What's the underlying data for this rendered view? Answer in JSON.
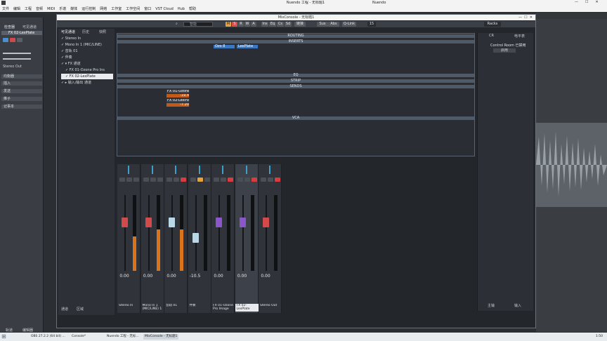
{
  "outer": {
    "title": "Nuendo 工程 - 无标题1",
    "app_name": "Nuendo",
    "menu": [
      "文件",
      "编辑",
      "工程",
      "音频",
      "MIDI",
      "乐谱",
      "媒体",
      "运行控制",
      "网络",
      "工作室",
      "工作空间",
      "窗口",
      "VST Cloud",
      "Hub",
      "帮助"
    ]
  },
  "inspector": {
    "tabs": [
      "检查器",
      "可见通道"
    ],
    "track_name": "FX 02-LexPlate",
    "sections": [
      "均衡器",
      "插入",
      "发送",
      "推子",
      "记事本"
    ],
    "bottom_tabs": [
      "轨道",
      "编辑器"
    ],
    "output": "Stereo Out"
  },
  "mix": {
    "title": "MixConsole - 无标题1",
    "toolbar": {
      "search_placeholder": "智能",
      "buttons": [
        "M",
        "S",
        "R",
        "W",
        "A"
      ],
      "tools": [
        "Ins",
        "Eq",
        "Cs",
        "Sd"
      ],
      "view_label": "链接",
      "sus": "Sus",
      "abs": "Abs",
      "qlink": "Q-Link",
      "count": "15",
      "racks": "Racks"
    },
    "left_tabs": [
      "可见通道",
      "历史",
      "快照"
    ],
    "vis_items": [
      "Stereo In",
      "Mono In 1 (MIC/LINE)",
      "音轨 01",
      "伴奏",
      "FX 通道",
      "FX 01-Ozone Pro Ins",
      "FX 02-LexPlate",
      "输入/输出 通道"
    ],
    "rack_labels": [
      "ROUTING",
      "INSERTS",
      "EQ",
      "STRIP",
      "SENDS",
      "VCA"
    ],
    "inserts": {
      "slot1": "Ozo 8",
      "slot2": "LexPlate"
    },
    "sends": {
      "send1": "FX 01-Ozone_...",
      "send1_val": "-19.4",
      "send2": "FX 02-LexPlate",
      "send2_val": "-7.20"
    },
    "channels": [
      {
        "name": "Stereo In",
        "volume": "0.00",
        "fader_color": "#d24a4a",
        "meter": 0.45
      },
      {
        "name": "Mono In 1 (MIC/LINE) 1",
        "volume": "0.00",
        "fader_color": "#d24a4a",
        "meter": 0.55
      },
      {
        "name": "音轨 01",
        "volume": "0.00",
        "fader_color": "#b9d7e6",
        "meter": 0.55
      },
      {
        "name": "伴奏",
        "volume": "-10.5",
        "fader_color": "#b9d7e6",
        "meter": 0.0
      },
      {
        "name": "FX 01-Ozone Pro Image",
        "volume": "0.00",
        "fader_color": "#8a56c9",
        "meter": 0.0
      },
      {
        "name": "FX 02-LexPlate",
        "volume": "0.00",
        "fader_color": "#8a56c9",
        "meter": 0.0
      },
      {
        "name": "Stereo Out",
        "volume": "0.00",
        "fader_color": "#d24a4a",
        "meter": 0.0
      }
    ],
    "bottom_tabs": [
      "通道",
      "区域"
    ],
    "right_panel": {
      "tabs": [
        "CR",
        "电平表"
      ],
      "control_room": "Control Room 已禁用",
      "enable_btn": "启用",
      "bottom_tabs": [
        "主输",
        "输入"
      ]
    }
  },
  "taskbar": {
    "items": [
      "OBS 27.2.2 (64 bit) ...",
      "Console*",
      "Nuendo 工程 - 无标...",
      "MixConsole - 无标题1"
    ],
    "time": "1:50"
  }
}
